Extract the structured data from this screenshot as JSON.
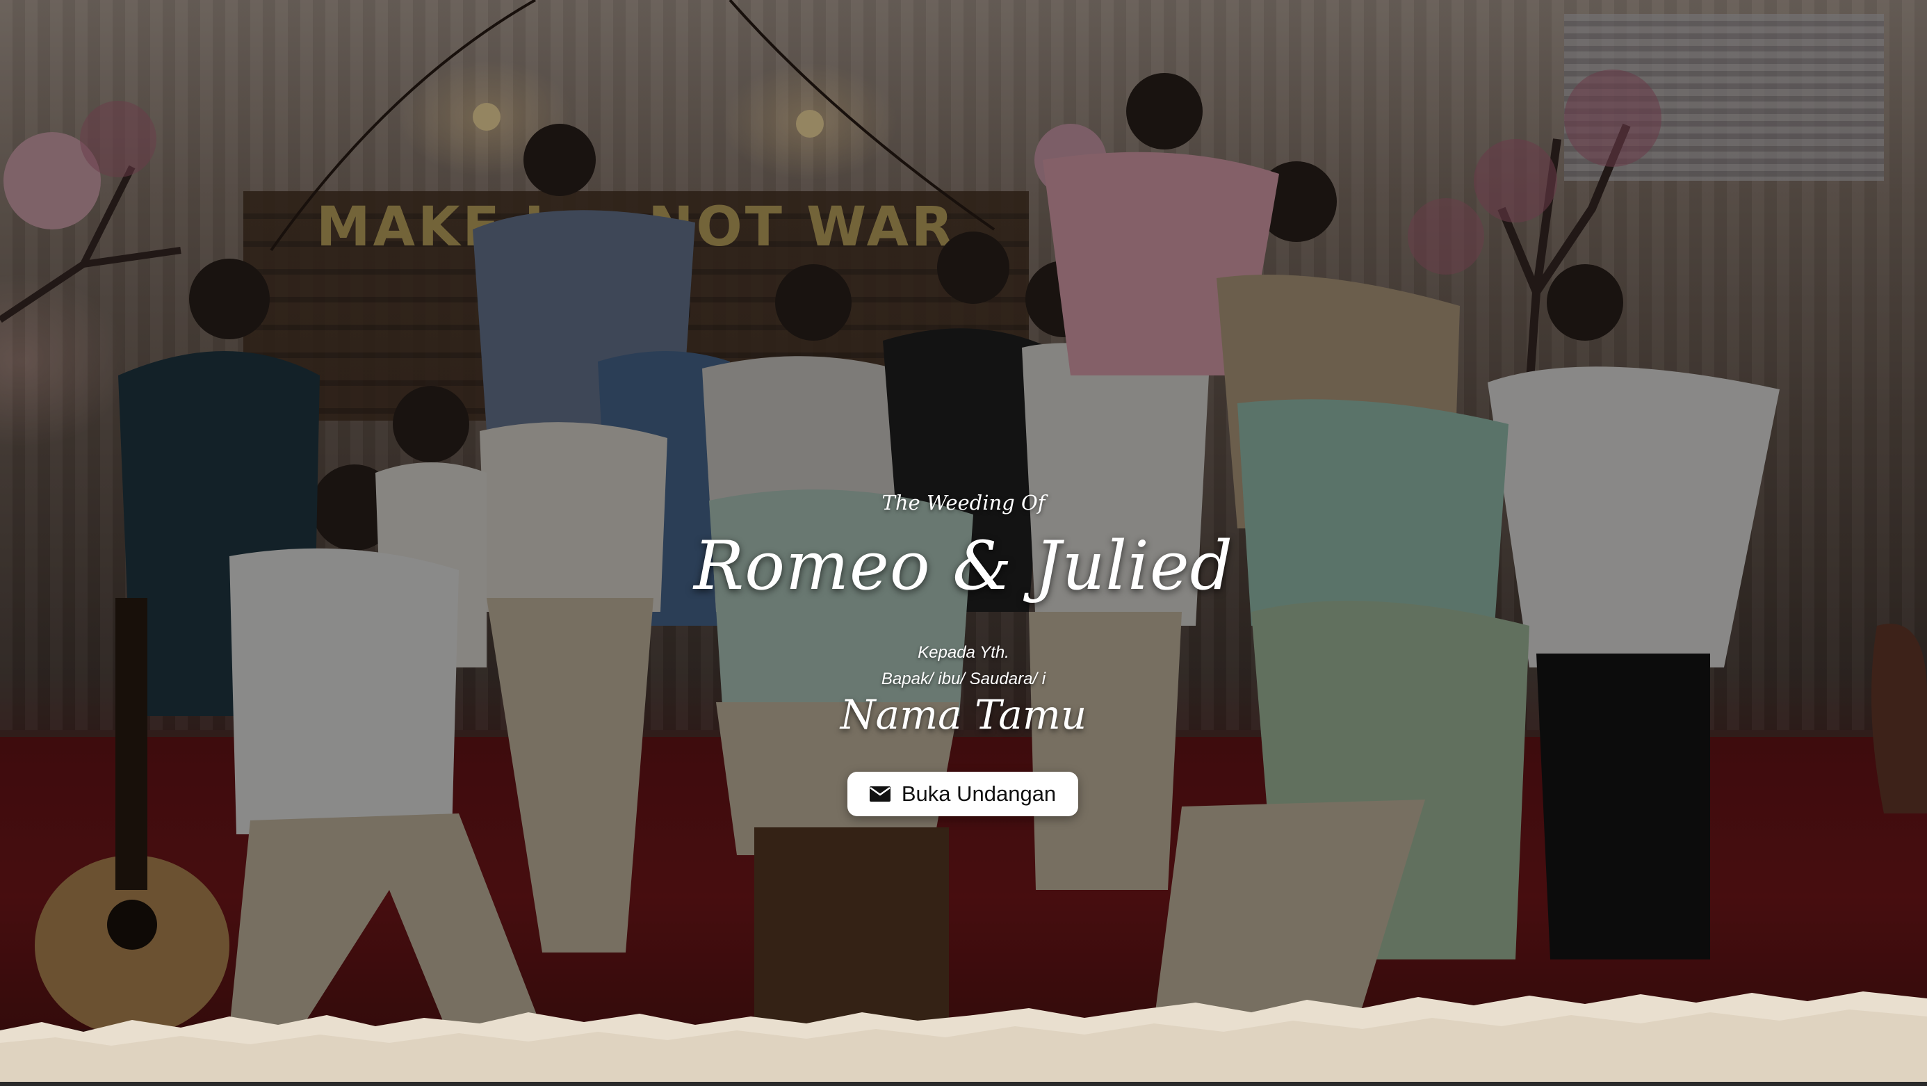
{
  "cover": {
    "subtitle": "The Weeding Of",
    "couple_names": "Romeo & Julied",
    "to_label": "Kepada Yth.",
    "salutation": "Bapak/ ibu/ Saudara/ i",
    "guest_name": "Nama Tamu",
    "open_button": {
      "label": "Buka Undangan",
      "icon": "envelope-icon"
    }
  },
  "background": {
    "sign_text": "MAKE L    NOT WAR",
    "description_icon": "group-photo"
  },
  "colors": {
    "text": "#ffffff",
    "button_bg": "#ffffff",
    "button_text": "#111111",
    "paper": "#e9dfcf",
    "floor": "#7a181b"
  }
}
